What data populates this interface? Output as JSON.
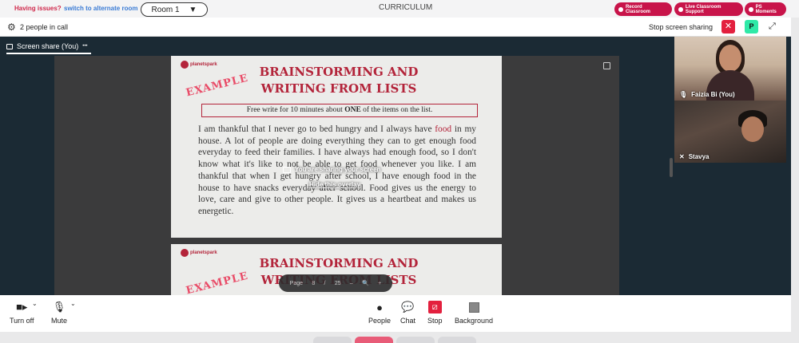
{
  "topbar": {
    "issues_text": "Having issues?",
    "switch_text": "switch to alternate room",
    "room_label": "Room 1",
    "room_caret": "▼",
    "center_title": "CURRICULUM",
    "pills": [
      "Record Classroom",
      "Live Classroom Support",
      "PS Moments"
    ]
  },
  "callbar": {
    "people_text": "2 people in call",
    "stop_share_text": "Stop screen sharing",
    "close_glyph": "✕",
    "p_badge": "P"
  },
  "stage": {
    "tab_label": "Screen share (You)",
    "tab_more": "•••",
    "overlay_text": "You are sharing your screen",
    "hide_overlay": "Hide this overlay",
    "pdf_controls": [
      "Page",
      "8",
      "/",
      "25",
      "–",
      "🔍",
      "+"
    ]
  },
  "document": {
    "brand": "planetspark",
    "example_stamp": "EXAMPLE",
    "title_line1": "BRAINSTORMING AND",
    "title_line2": "WRITING FROM LISTS",
    "prompt_pre": "Free write for 10 minutes about ",
    "prompt_bold": "ONE",
    "prompt_post": " of the items on the list.",
    "essay_start": "I am thankful that I never go to bed hungry and I always have ",
    "essay_red": "food",
    "essay_rest": " in my house.  A lot of people are doing everything they can to get enough food everyday to feed their families. I have always had enough food, so I don't know what it's like to not be able to get food whenever you like. I am thankful that when I get hungry after school, I have enough food in the house to have snacks everyday after school. Food gives us the energy to love, care and give to other people. It gives us a heartbeat and makes us energetic.",
    "page2_title_line1": "BRAINSTORMING AND",
    "page2_title_line2": "WRITING FROM LISTS"
  },
  "participants": [
    {
      "name": "Faizia Bi (You)",
      "icon": "mic-icon"
    },
    {
      "name": "Stavya",
      "icon": "mic-off-icon"
    }
  ],
  "toolbar": {
    "turn_off": "Turn off",
    "mute": "Mute",
    "people": "People",
    "chat": "Chat",
    "stop": "Stop",
    "background": "Background"
  },
  "colors": {
    "accent": "#c8144a",
    "stop_red": "#e3203e",
    "p_green": "#2fe9a7",
    "stage_bg": "#1b2a34"
  }
}
